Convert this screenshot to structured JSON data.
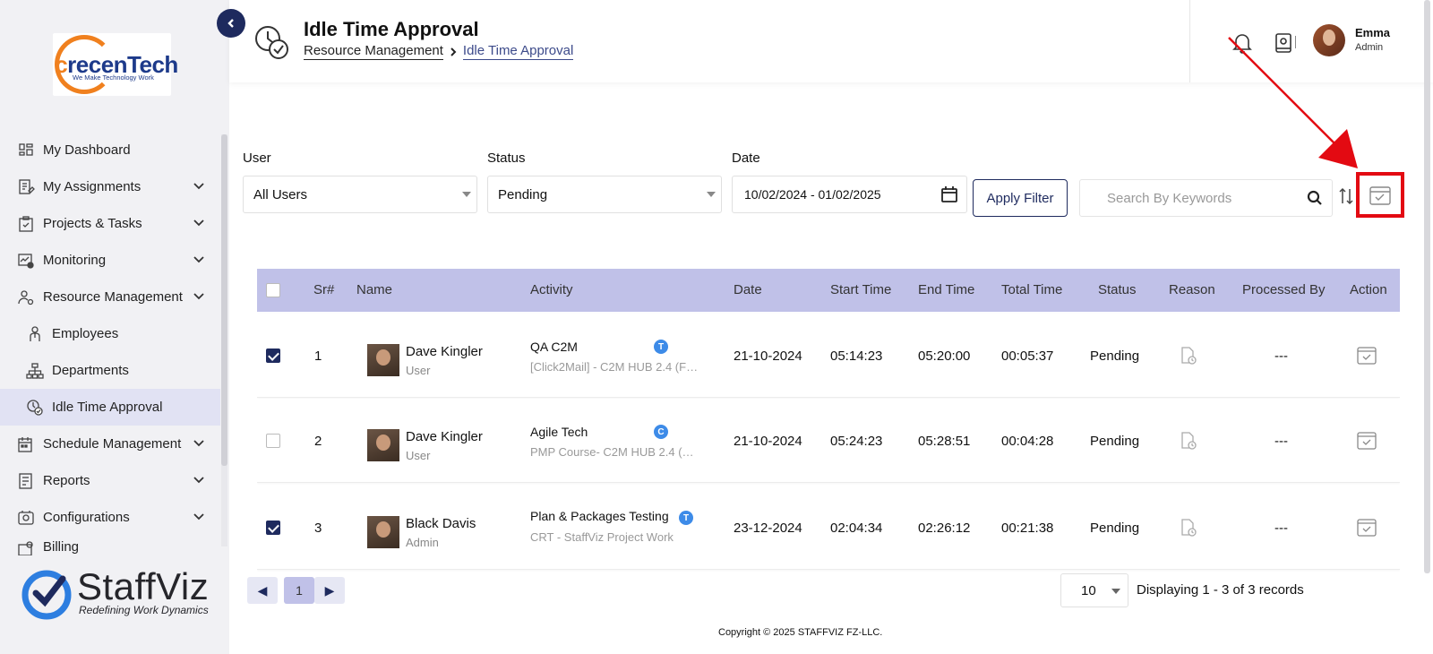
{
  "brand": {
    "logo_name": "recenTech",
    "logo_initial": "c",
    "logo_tagline": "We Make Technology Work",
    "product_name": "StaffViz",
    "product_tagline": "Redefining Work Dynamics"
  },
  "sidebar": {
    "items": [
      {
        "label": "My Dashboard",
        "icon": "dashboard-icon"
      },
      {
        "label": "My Assignments",
        "icon": "assignments-icon"
      },
      {
        "label": "Projects & Tasks",
        "icon": "clipboard-icon"
      },
      {
        "label": "Monitoring",
        "icon": "monitoring-icon"
      },
      {
        "label": "Resource Management",
        "icon": "users-gear-icon"
      },
      {
        "label": "Employees",
        "icon": "employee-icon"
      },
      {
        "label": "Departments",
        "icon": "hierarchy-icon"
      },
      {
        "label": "Idle Time Approval",
        "icon": "clock-check-icon"
      },
      {
        "label": "Schedule Management",
        "icon": "calendar-icon"
      },
      {
        "label": "Reports",
        "icon": "report-icon"
      },
      {
        "label": "Configurations",
        "icon": "config-icon"
      },
      {
        "label": "Billing",
        "icon": "billing-icon"
      }
    ]
  },
  "header": {
    "title": "Idle Time Approval",
    "breadcrumb_parent": "Resource Management",
    "breadcrumb_current": "Idle Time Approval",
    "user_name": "Emma",
    "user_role": "Admin"
  },
  "filters": {
    "user_label": "User",
    "user_value": "All Users",
    "status_label": "Status",
    "status_value": "Pending",
    "date_label": "Date",
    "date_value": "10/02/2024 - 01/02/2025",
    "apply_label": "Apply Filter",
    "search_placeholder": "Search By Keywords"
  },
  "table": {
    "headers": [
      "Sr#",
      "Name",
      "Activity",
      "Date",
      "Start Time",
      "End Time",
      "Total Time",
      "Status",
      "Reason",
      "Processed By",
      "Action"
    ],
    "rows": [
      {
        "checked": true,
        "sr": "1",
        "name": "Dave Kingler",
        "role": "User",
        "activity": "QA C2M",
        "badge": "T",
        "desc": "[Click2Mail] - C2M HUB 2.4 (FU...",
        "date": "21-10-2024",
        "start": "05:14:23",
        "end": "05:20:00",
        "total": "00:05:37",
        "status": "Pending",
        "processed_by": "---"
      },
      {
        "checked": false,
        "sr": "2",
        "name": "Dave Kingler",
        "role": "User",
        "activity": "Agile Tech",
        "badge": "C",
        "desc": "PMP Course- C2M HUB 2.4 (FU...",
        "date": "21-10-2024",
        "start": "05:24:23",
        "end": "05:28:51",
        "total": "00:04:28",
        "status": "Pending",
        "processed_by": "---"
      },
      {
        "checked": true,
        "sr": "3",
        "name": "Black Davis",
        "role": "Admin",
        "activity": "Plan & Packages Testing",
        "badge": "T",
        "desc": "CRT - StaffViz Project Work",
        "date": "23-12-2024",
        "start": "02:04:34",
        "end": "02:26:12",
        "total": "00:21:38",
        "status": "Pending",
        "processed_by": "---"
      }
    ]
  },
  "pagination": {
    "prev": "◀",
    "page": "1",
    "next": "▶",
    "per_page": "10",
    "records": "Displaying 1 - 3 of 3 records"
  },
  "footer": {
    "copyright": "Copyright © 2025 STAFFVIZ FZ-LLC."
  },
  "colors": {
    "primary": "#1e2a5e",
    "table_header": "#c0c1e8",
    "highlight": "#e30a12",
    "accent": "#f0801e",
    "badge": "#3d8be8"
  }
}
